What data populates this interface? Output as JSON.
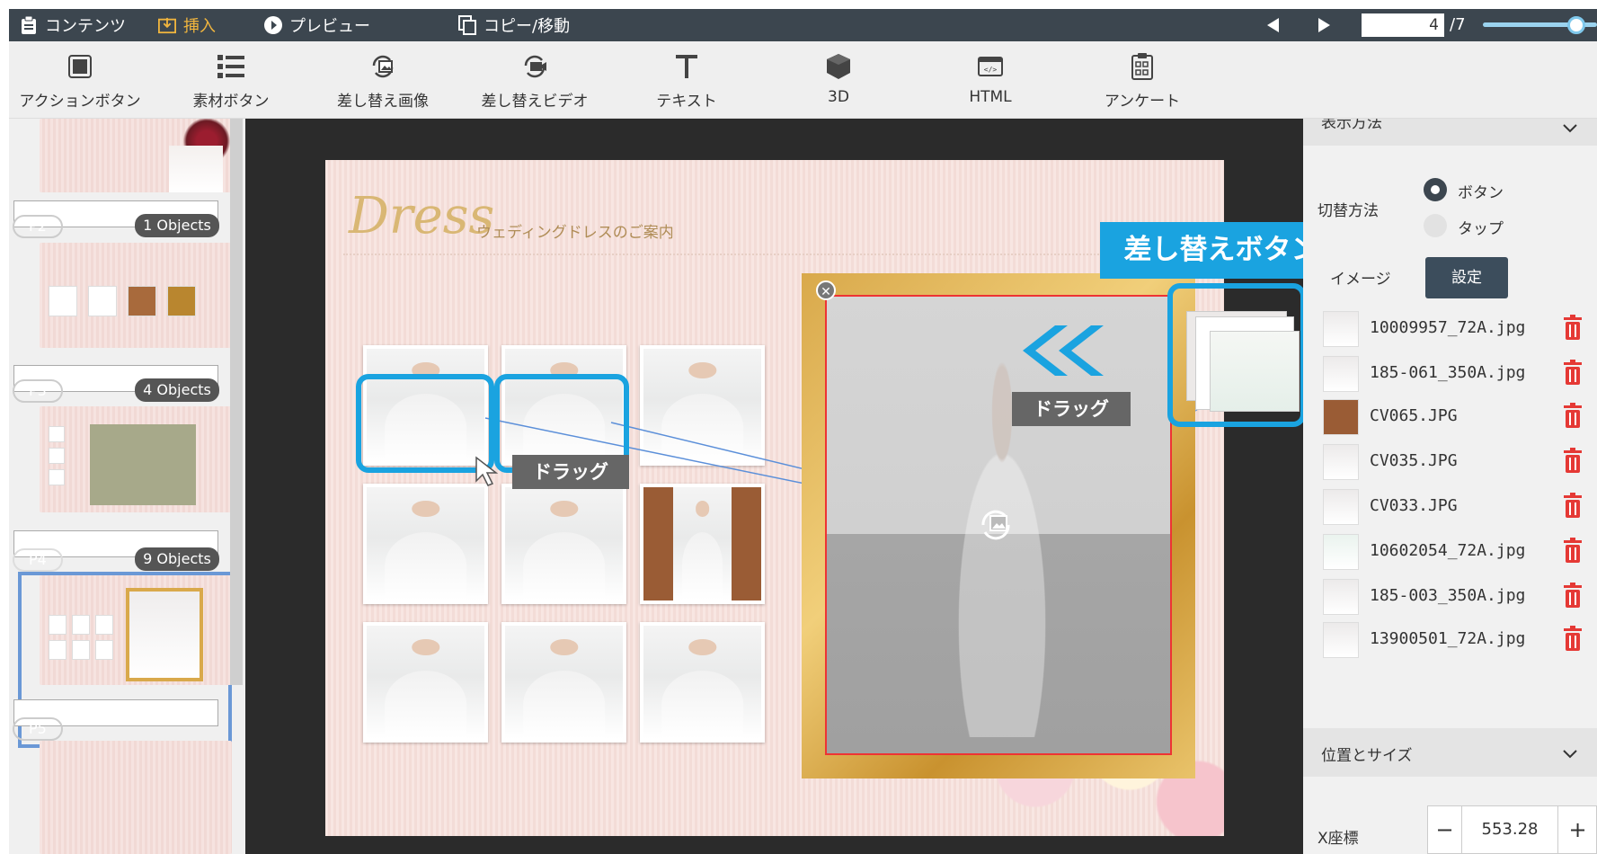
{
  "topbar": {
    "contents": "コンテンツ",
    "insert": "挿入",
    "preview": "プレビュー",
    "copy_move": "コピー/移動",
    "page_current": "4",
    "page_total": "/7",
    "zoom_level": 0.82
  },
  "toolbar": {
    "items": [
      {
        "label": "アクションボタン",
        "icon": "square-icon"
      },
      {
        "label": "素材ボタン",
        "icon": "list-icon"
      },
      {
        "label": "差し替え画像",
        "icon": "swap-image-icon"
      },
      {
        "label": "差し替えビデオ",
        "icon": "swap-video-icon"
      },
      {
        "label": "テキスト",
        "icon": "text-icon"
      },
      {
        "label": "3D",
        "icon": "cube-icon"
      },
      {
        "label": "HTML",
        "icon": "html-icon"
      },
      {
        "label": "アンケート",
        "icon": "survey-icon"
      }
    ]
  },
  "pages": [
    {
      "tag": "P2",
      "objects": "1 Objects"
    },
    {
      "tag": "P3",
      "objects": "4 Objects"
    },
    {
      "tag": "P4",
      "objects": "9 Objects"
    },
    {
      "tag": "P5",
      "objects": ""
    }
  ],
  "canvas": {
    "title_script": "Dress",
    "title_sub": "ウェディングドレスのご案内",
    "drag_label_1": "ドラッグ",
    "drag_label_2": "ドラッグ",
    "callout": "差し替えボタン"
  },
  "right": {
    "section_display_method": "表示方法",
    "switch_method_label": "切替方法",
    "option_button": "ボタン",
    "option_tap": "タップ",
    "image_label": "イメージ",
    "set_button": "設定",
    "files": [
      "10009957_72A.jpg",
      "185-061_350A.jpg",
      "CV065.JPG",
      "CV035.JPG",
      "CV033.JPG",
      "10602054_72A.jpg",
      "185-003_350A.jpg",
      "13900501_72A.jpg"
    ],
    "section_position_size": "位置とサイズ",
    "x_label": "X座標",
    "x_value": "553.28",
    "minus": "−",
    "plus": "+"
  },
  "colors": {
    "accent": "#1aa3e0",
    "topbar_bg": "#3c464f",
    "active_tab": "#f0b53e",
    "delete_red": "#e53935"
  }
}
